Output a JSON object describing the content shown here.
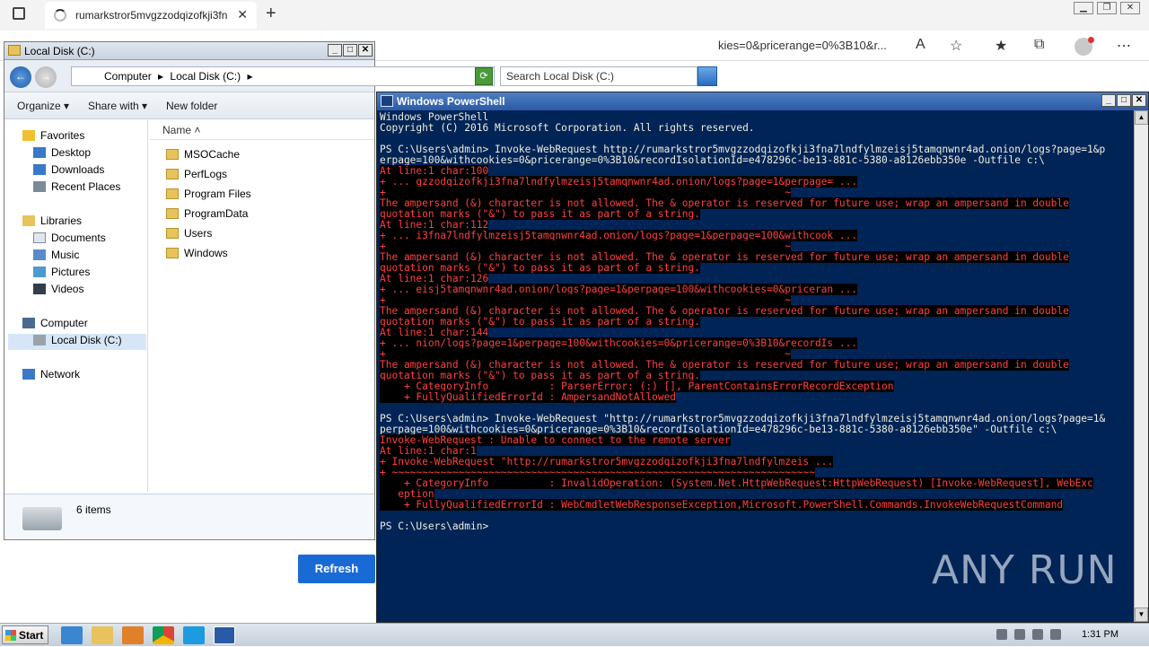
{
  "browser": {
    "tab_title": "rumarkstror5mvgzzodqizofkji3fn",
    "address_fragment": "kies=0&pricerange=0%3B10&r...",
    "window_controls": [
      "▁",
      "❐",
      "✕"
    ]
  },
  "explorer": {
    "title": "Local Disk (C:)",
    "breadcrumb": [
      "Computer",
      "▸",
      "Local Disk (C:)",
      "▸"
    ],
    "search_placeholder": "Search Local Disk (C:)",
    "commands": {
      "organize": "Organize ▾",
      "share": "Share with ▾",
      "new_folder": "New folder"
    },
    "nav": {
      "favorites": "Favorites",
      "desktop": "Desktop",
      "downloads": "Downloads",
      "recent": "Recent Places",
      "libraries": "Libraries",
      "documents": "Documents",
      "music": "Music",
      "pictures": "Pictures",
      "videos": "Videos",
      "computer": "Computer",
      "local_disk": "Local Disk (C:)",
      "network": "Network"
    },
    "column_header": "Name",
    "files": [
      "MSOCache",
      "PerfLogs",
      "Program Files",
      "ProgramData",
      "Users",
      "Windows"
    ],
    "status": "6 items"
  },
  "page": {
    "refresh_label": "Refresh"
  },
  "powershell": {
    "title": "Windows PowerShell",
    "lines": [
      {
        "t": "Windows PowerShell",
        "e": false
      },
      {
        "t": "Copyright (C) 2016 Microsoft Corporation. All rights reserved.",
        "e": false
      },
      {
        "t": "",
        "e": false
      },
      {
        "t": "PS C:\\Users\\admin> Invoke-WebRequest http://rumarkstror5mvgzzodqizofkji3fna7lndfylmzeisj5tamqnwnr4ad.onion/logs?page=1&p",
        "e": false
      },
      {
        "t": "erpage=100&withcookies=0&pricerange=0%3B10&recordIsolationId=e478296c-be13-881c-5380-a8126ebb350e -Outfile c:\\",
        "e": false
      },
      {
        "t": "At line:1 char:100",
        "e": true
      },
      {
        "t": "+ ... gzzodqizofkji3fna7lndfylmzeisj5tamqnwnr4ad.onion/logs?page=1&perpage= ...",
        "e": true
      },
      {
        "t": "+                                                                  ~",
        "e": true
      },
      {
        "t": "The ampersand (&) character is not allowed. The & operator is reserved for future use; wrap an ampersand in double",
        "e": true
      },
      {
        "t": "quotation marks (\"&\") to pass it as part of a string.",
        "e": true
      },
      {
        "t": "At line:1 char:112",
        "e": true
      },
      {
        "t": "+ ... i3fna7lndfylmzeisj5tamqnwnr4ad.onion/logs?page=1&perpage=100&withcook ...",
        "e": true
      },
      {
        "t": "+                                                                  ~",
        "e": true
      },
      {
        "t": "The ampersand (&) character is not allowed. The & operator is reserved for future use; wrap an ampersand in double",
        "e": true
      },
      {
        "t": "quotation marks (\"&\") to pass it as part of a string.",
        "e": true
      },
      {
        "t": "At line:1 char:126",
        "e": true
      },
      {
        "t": "+ ... eisj5tamqnwnr4ad.onion/logs?page=1&perpage=100&withcookies=0&priceran ...",
        "e": true
      },
      {
        "t": "+                                                                  ~",
        "e": true
      },
      {
        "t": "The ampersand (&) character is not allowed. The & operator is reserved for future use; wrap an ampersand in double",
        "e": true
      },
      {
        "t": "quotation marks (\"&\") to pass it as part of a string.",
        "e": true
      },
      {
        "t": "At line:1 char:144",
        "e": true
      },
      {
        "t": "+ ... nion/logs?page=1&perpage=100&withcookies=0&pricerange=0%3B10&recordIs ...",
        "e": true
      },
      {
        "t": "+                                                                  ~",
        "e": true
      },
      {
        "t": "The ampersand (&) character is not allowed. The & operator is reserved for future use; wrap an ampersand in double",
        "e": true
      },
      {
        "t": "quotation marks (\"&\") to pass it as part of a string.",
        "e": true
      },
      {
        "t": "    + CategoryInfo          : ParserError: (:) [], ParentContainsErrorRecordException",
        "e": true
      },
      {
        "t": "    + FullyQualifiedErrorId : AmpersandNotAllowed",
        "e": true
      },
      {
        "t": "",
        "e": false
      },
      {
        "t": "PS C:\\Users\\admin> Invoke-WebRequest \"http://rumarkstror5mvgzzodqizofkji3fna7lndfylmzeisj5tamqnwnr4ad.onion/logs?page=1&",
        "e": false
      },
      {
        "t": "perpage=100&withcookies=0&pricerange=0%3B10&recordIsolationId=e478296c-be13-881c-5380-a8126ebb350e\" -Outfile c:\\",
        "e": false
      },
      {
        "t": "Invoke-WebRequest : Unable to connect to the remote server",
        "e": true
      },
      {
        "t": "At line:1 char:1",
        "e": true
      },
      {
        "t": "+ Invoke-WebRequest \"http://rumarkstror5mvgzzodqizofkji3fna7lndfylmzeis ...",
        "e": true
      },
      {
        "t": "+ ~~~~~~~~~~~~~~~~~~~~~~~~~~~~~~~~~~~~~~~~~~~~~~~~~~~~~~~~~~~~~~~~~~~~~~",
        "e": true
      },
      {
        "t": "    + CategoryInfo          : InvalidOperation: (System.Net.HttpWebRequest:HttpWebRequest) [Invoke-WebRequest], WebExc",
        "e": true
      },
      {
        "t": "   eption",
        "e": true
      },
      {
        "t": "    + FullyQualifiedErrorId : WebCmdletWebResponseException,Microsoft.PowerShell.Commands.InvokeWebRequestCommand",
        "e": true
      },
      {
        "t": "",
        "e": false
      },
      {
        "t": "PS C:\\Users\\admin>",
        "e": false
      }
    ]
  },
  "watermark": "ANY RUN",
  "taskbar": {
    "start_label": "Start",
    "clock": "1:31 PM"
  },
  "colors": {
    "ps_background": "#012456",
    "ps_error": "#ff4040",
    "accent": "#1a6ad6"
  }
}
